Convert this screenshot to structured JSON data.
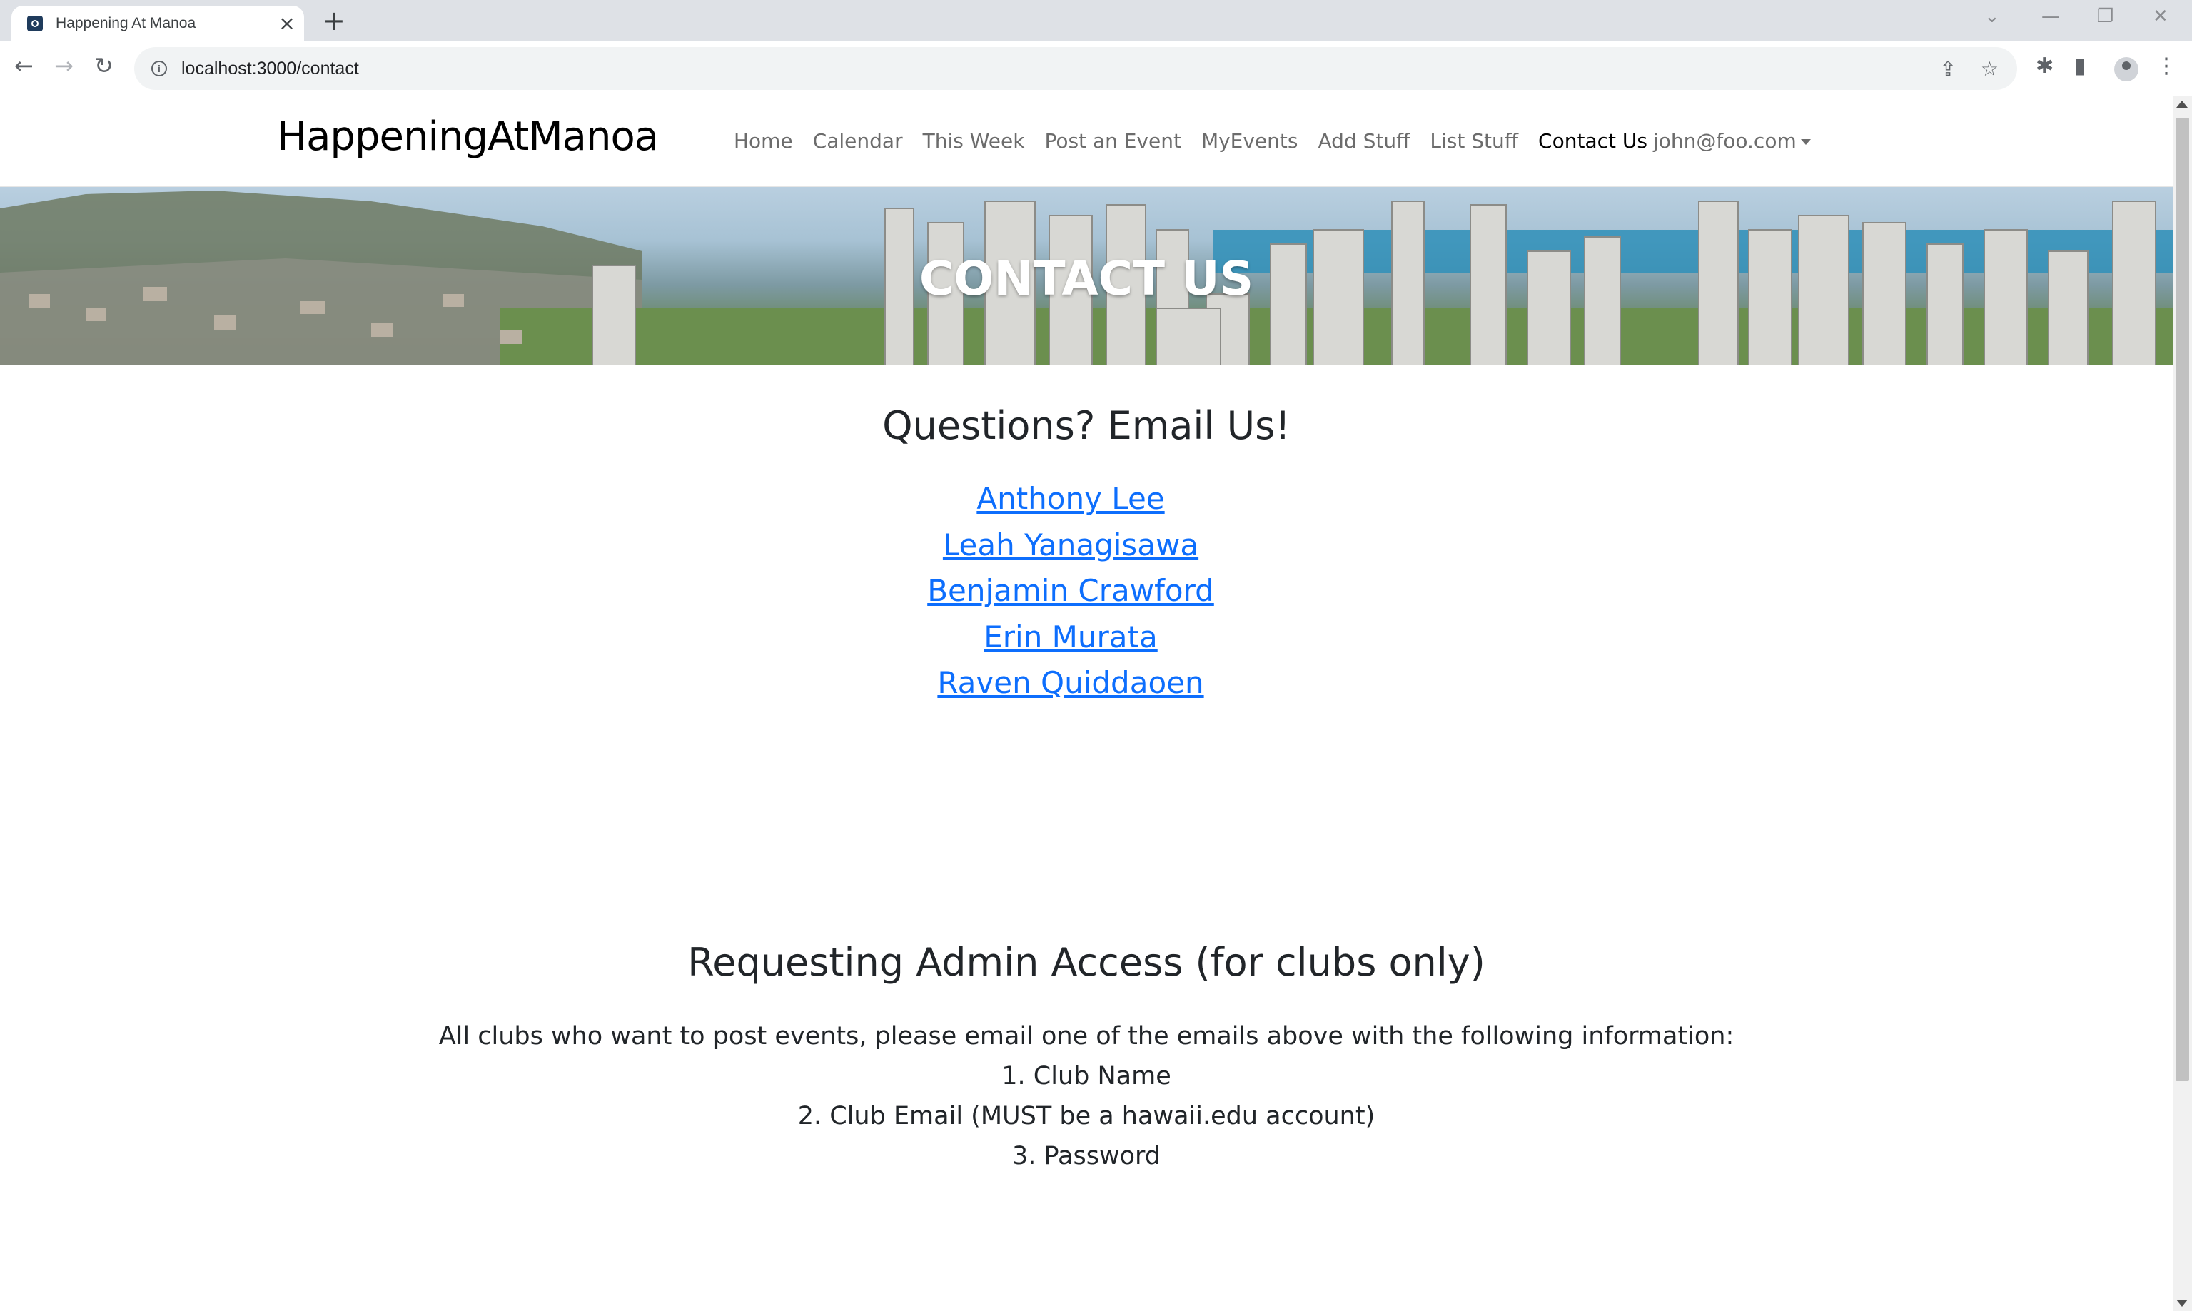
{
  "browser": {
    "tab_title": "Happening At Manoa",
    "url": "localhost:3000/contact"
  },
  "navbar": {
    "brand": "HappeningAtManoa",
    "links": [
      "Home",
      "Calendar",
      "This Week",
      "Post an Event",
      "MyEvents",
      "Add Stuff",
      "List Stuff",
      "Contact Us"
    ],
    "active_link": "Contact Us",
    "user": "john@foo.com"
  },
  "hero": {
    "title": "CONTACT US"
  },
  "email_section": {
    "heading": "Questions? Email Us!",
    "contacts": [
      "Anthony Lee",
      "Leah Yanagisawa",
      "Benjamin Crawford",
      "Erin Murata",
      "Raven Quiddaoen"
    ]
  },
  "admin_section": {
    "heading": "Requesting Admin Access (for clubs only)",
    "intro": "All clubs who want to post events, please email one of the emails above with the following information:",
    "items": [
      "1. Club Name",
      "2. Club Email (MUST be a hawaii.edu account)",
      "3. Password"
    ]
  }
}
